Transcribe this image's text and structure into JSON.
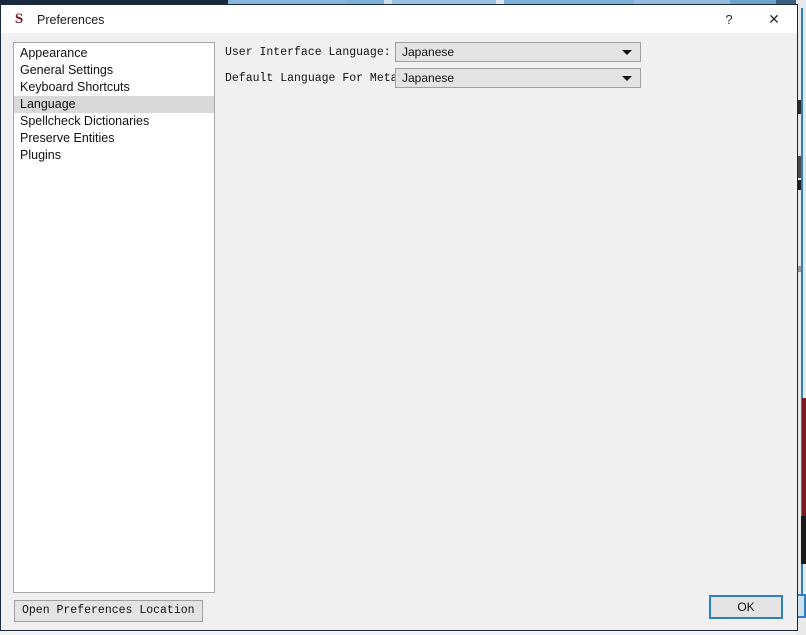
{
  "window": {
    "title": "Preferences",
    "app_icon": "sigil-s-icon",
    "app_icon_glyph": "S",
    "app_icon_color": "#7a1b22",
    "controls": {
      "help_label": "?",
      "close_label": "✕"
    }
  },
  "sidebar": {
    "name": "preferences-category-list",
    "selected": "Language",
    "items": [
      {
        "label": "Appearance",
        "selected": false
      },
      {
        "label": "General Settings",
        "selected": false
      },
      {
        "label": "Keyboard Shortcuts",
        "selected": false
      },
      {
        "label": "Language",
        "selected": true
      },
      {
        "label": "Spellcheck Dictionaries",
        "selected": false
      },
      {
        "label": "Preserve Entities",
        "selected": false
      },
      {
        "label": "Plugins",
        "selected": false
      }
    ]
  },
  "form": {
    "rows": [
      {
        "label": "User Interface Language:",
        "value": "Japanese",
        "arrow_icon": "chevron-down-icon"
      },
      {
        "label": "Default Language For Metadata:",
        "value": "Japanese",
        "arrow_icon": "chevron-down-icon"
      }
    ]
  },
  "buttons": {
    "open_prefs_location": "Open Preferences Location",
    "ok": "OK"
  },
  "colors": {
    "dialog_background": "#f0f0f0",
    "titlebar_background": "#ffffff",
    "window_border": "#17293d",
    "list_background": "#ffffff",
    "list_border": "#a6a6a6",
    "selection_highlight": "#d9d9d9",
    "control_face": "#e3e3e3",
    "control_border": "#a0a0a0",
    "focus_accent": "#2f7fc4",
    "text": "#111111"
  }
}
